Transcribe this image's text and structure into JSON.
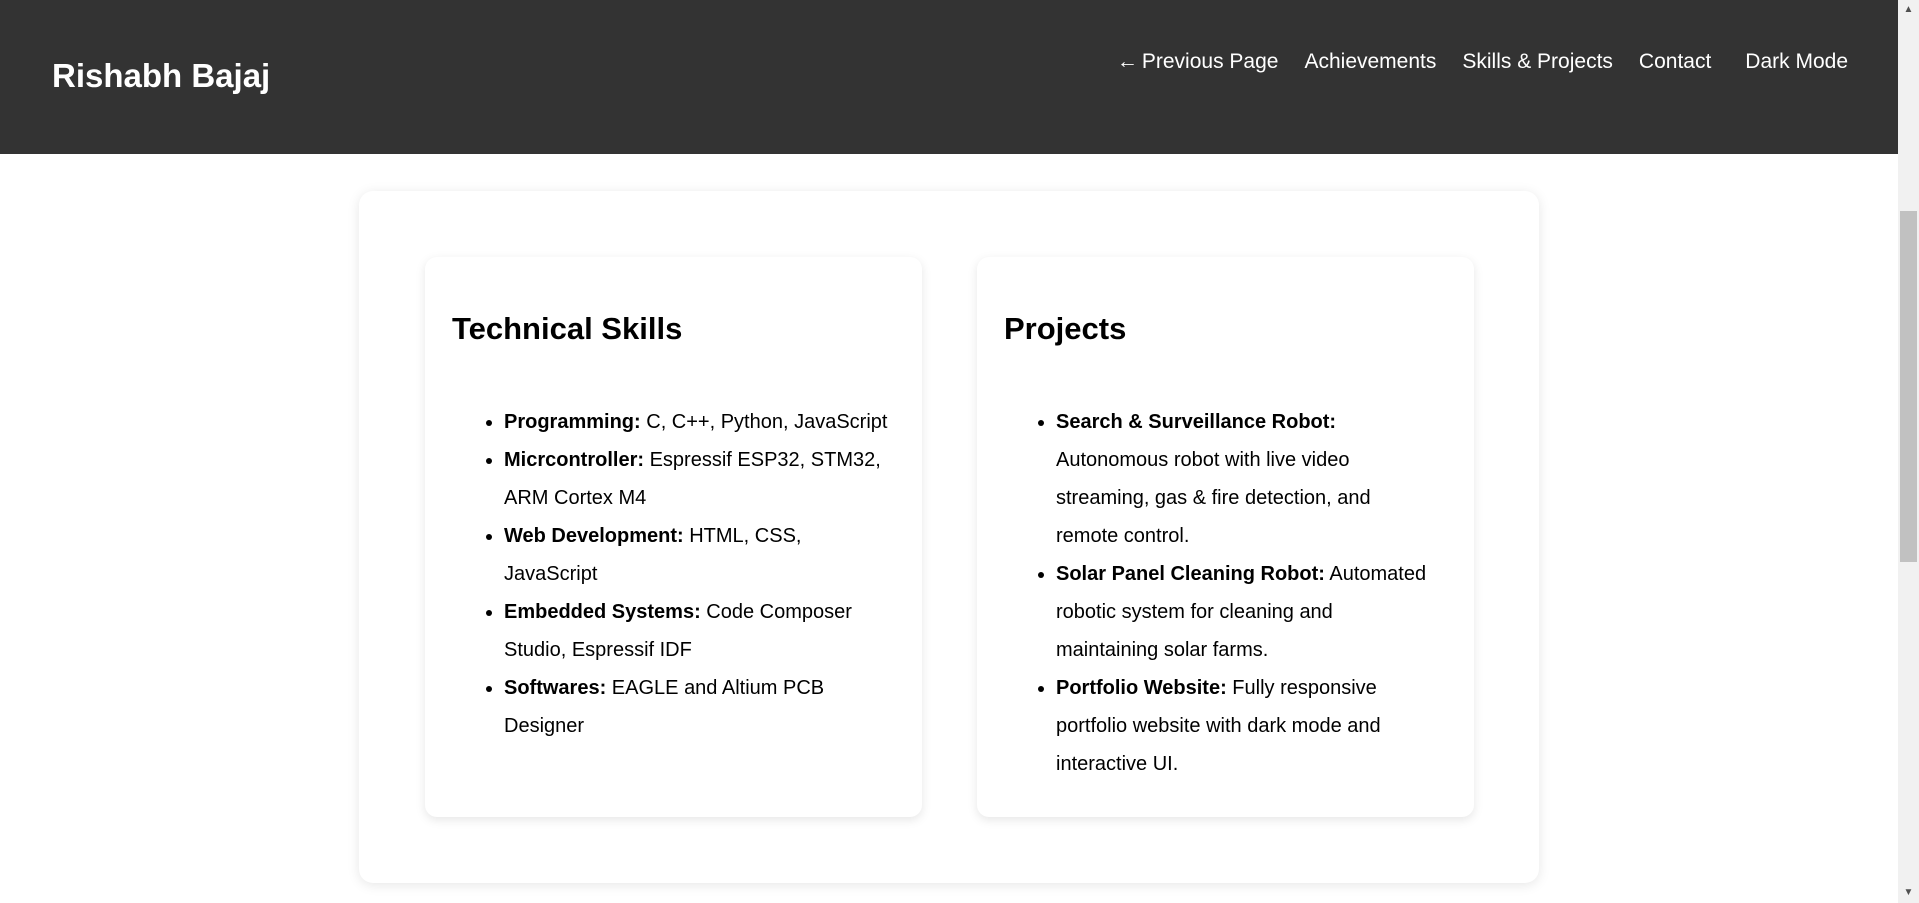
{
  "header": {
    "brand": "Rishabh Bajaj",
    "nav": {
      "previous_arrow": "←",
      "previous_label": "Previous Page",
      "achievements": "Achievements",
      "skills_projects": "Skills & Projects",
      "contact": "Contact",
      "dark_mode": "Dark Mode"
    }
  },
  "skills": {
    "title": "Technical Skills",
    "items": [
      {
        "label": "Programming:",
        "text": " C, C++, Python, JavaScript"
      },
      {
        "label": "Micrcontroller:",
        "text": " Espressif ESP32, STM32, ARM Cortex M4"
      },
      {
        "label": "Web Development:",
        "text": " HTML, CSS, JavaScript"
      },
      {
        "label": "Embedded Systems:",
        "text": " Code Composer Studio, Espressif IDF"
      },
      {
        "label": "Softwares:",
        "text": " EAGLE and Altium PCB Designer"
      }
    ]
  },
  "projects": {
    "title": "Projects",
    "items": [
      {
        "label": "Search & Surveillance Robot:",
        "text": " Autonomous robot with live video streaming, gas & fire detection, and remote control."
      },
      {
        "label": "Solar Panel Cleaning Robot:",
        "text": " Automated robotic system for cleaning and maintaining solar farms."
      },
      {
        "label": "Portfolio Website:",
        "text": " Fully responsive portfolio website with dark mode and interactive UI."
      }
    ]
  },
  "colors": {
    "header_bg": "#333333",
    "header_text": "#ffffff",
    "page_bg": "#ffffff",
    "text": "#000000"
  },
  "scrollbar": {
    "up_icon": "▲",
    "down_icon": "▼"
  }
}
